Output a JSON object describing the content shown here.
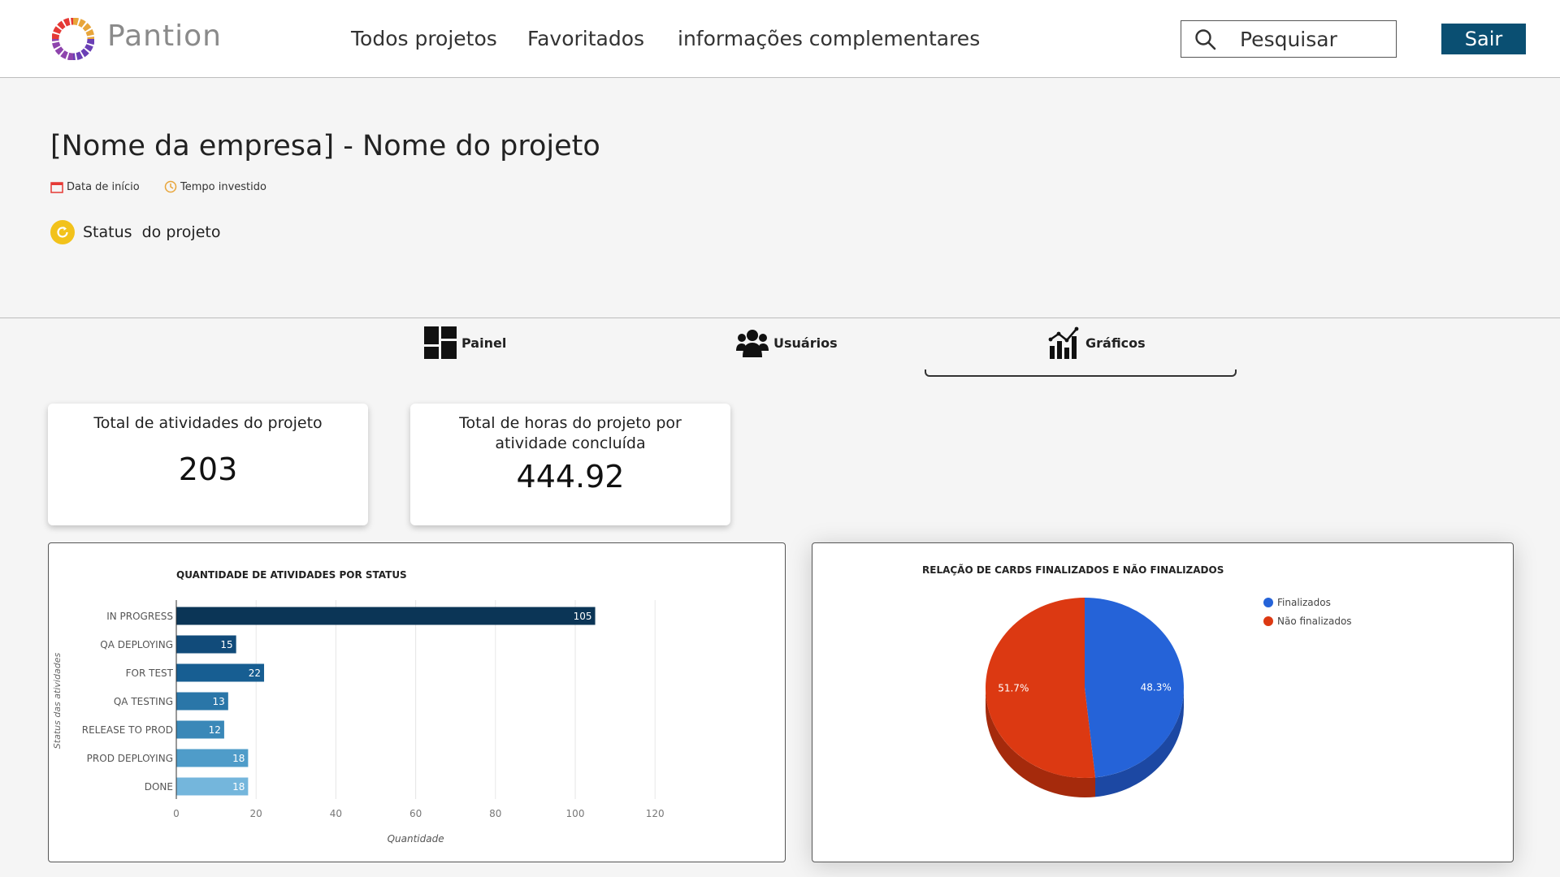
{
  "header": {
    "brand": "Pantion",
    "nav": [
      "Todos projetos",
      "Favoritados",
      "informações complementares"
    ],
    "search_placeholder": "Pesquisar",
    "logout_label": "Sair"
  },
  "project": {
    "title": "[Nome da empresa] - Nome do projeto",
    "start_date_label": "Data de início",
    "time_label": "Tempo investido",
    "status_label": "Status  do projeto"
  },
  "tabs": [
    {
      "label": "Painel",
      "icon": "dashboard-icon"
    },
    {
      "label": "Usuários",
      "icon": "users-icon"
    },
    {
      "label": "Gráficos",
      "icon": "chart-icon",
      "active": true
    }
  ],
  "kpis": [
    {
      "label": "Total de atividades do projeto",
      "value": "203"
    },
    {
      "label": "Total de horas do projeto por atividade concluída",
      "value": "444.92"
    }
  ],
  "colors": {
    "brand_button": "#0a4f72",
    "status_yellow": "#f2c21b",
    "pie_finalizados": "#2563d8",
    "pie_nao_finalizados": "#dc3912"
  },
  "chart_data": [
    {
      "type": "bar",
      "orientation": "horizontal",
      "title": "QUANTIDADE DE ATIVIDADES POR STATUS",
      "xlabel": "Quantidade",
      "ylabel": "Status das atividades",
      "categories": [
        "IN PROGRESS",
        "QA DEPLOYING",
        "FOR TEST",
        "QA TESTING",
        "RELEASE TO PROD",
        "PROD DEPLOYING",
        "DONE"
      ],
      "values": [
        105,
        15,
        22,
        13,
        12,
        18,
        18
      ],
      "colors": [
        "#0b3556",
        "#114b7a",
        "#175e92",
        "#2a76a8",
        "#3a88b8",
        "#4f9cc9",
        "#74b6dc"
      ],
      "xlim": [
        0,
        120
      ],
      "xticks": [
        0,
        20,
        40,
        60,
        80,
        100,
        120
      ],
      "grid": true
    },
    {
      "type": "pie",
      "title": "RELAÇÃO DE CARDS FINALIZADOS E NÃO FINALIZADOS",
      "labels": [
        "Finalizados",
        "Não finalizados"
      ],
      "values": [
        48.3,
        51.7
      ],
      "value_labels": [
        "48.3%",
        "51.7%"
      ],
      "colors": [
        "#2563d8",
        "#dc3912"
      ],
      "legend": "top-right",
      "style": "3d"
    }
  ]
}
